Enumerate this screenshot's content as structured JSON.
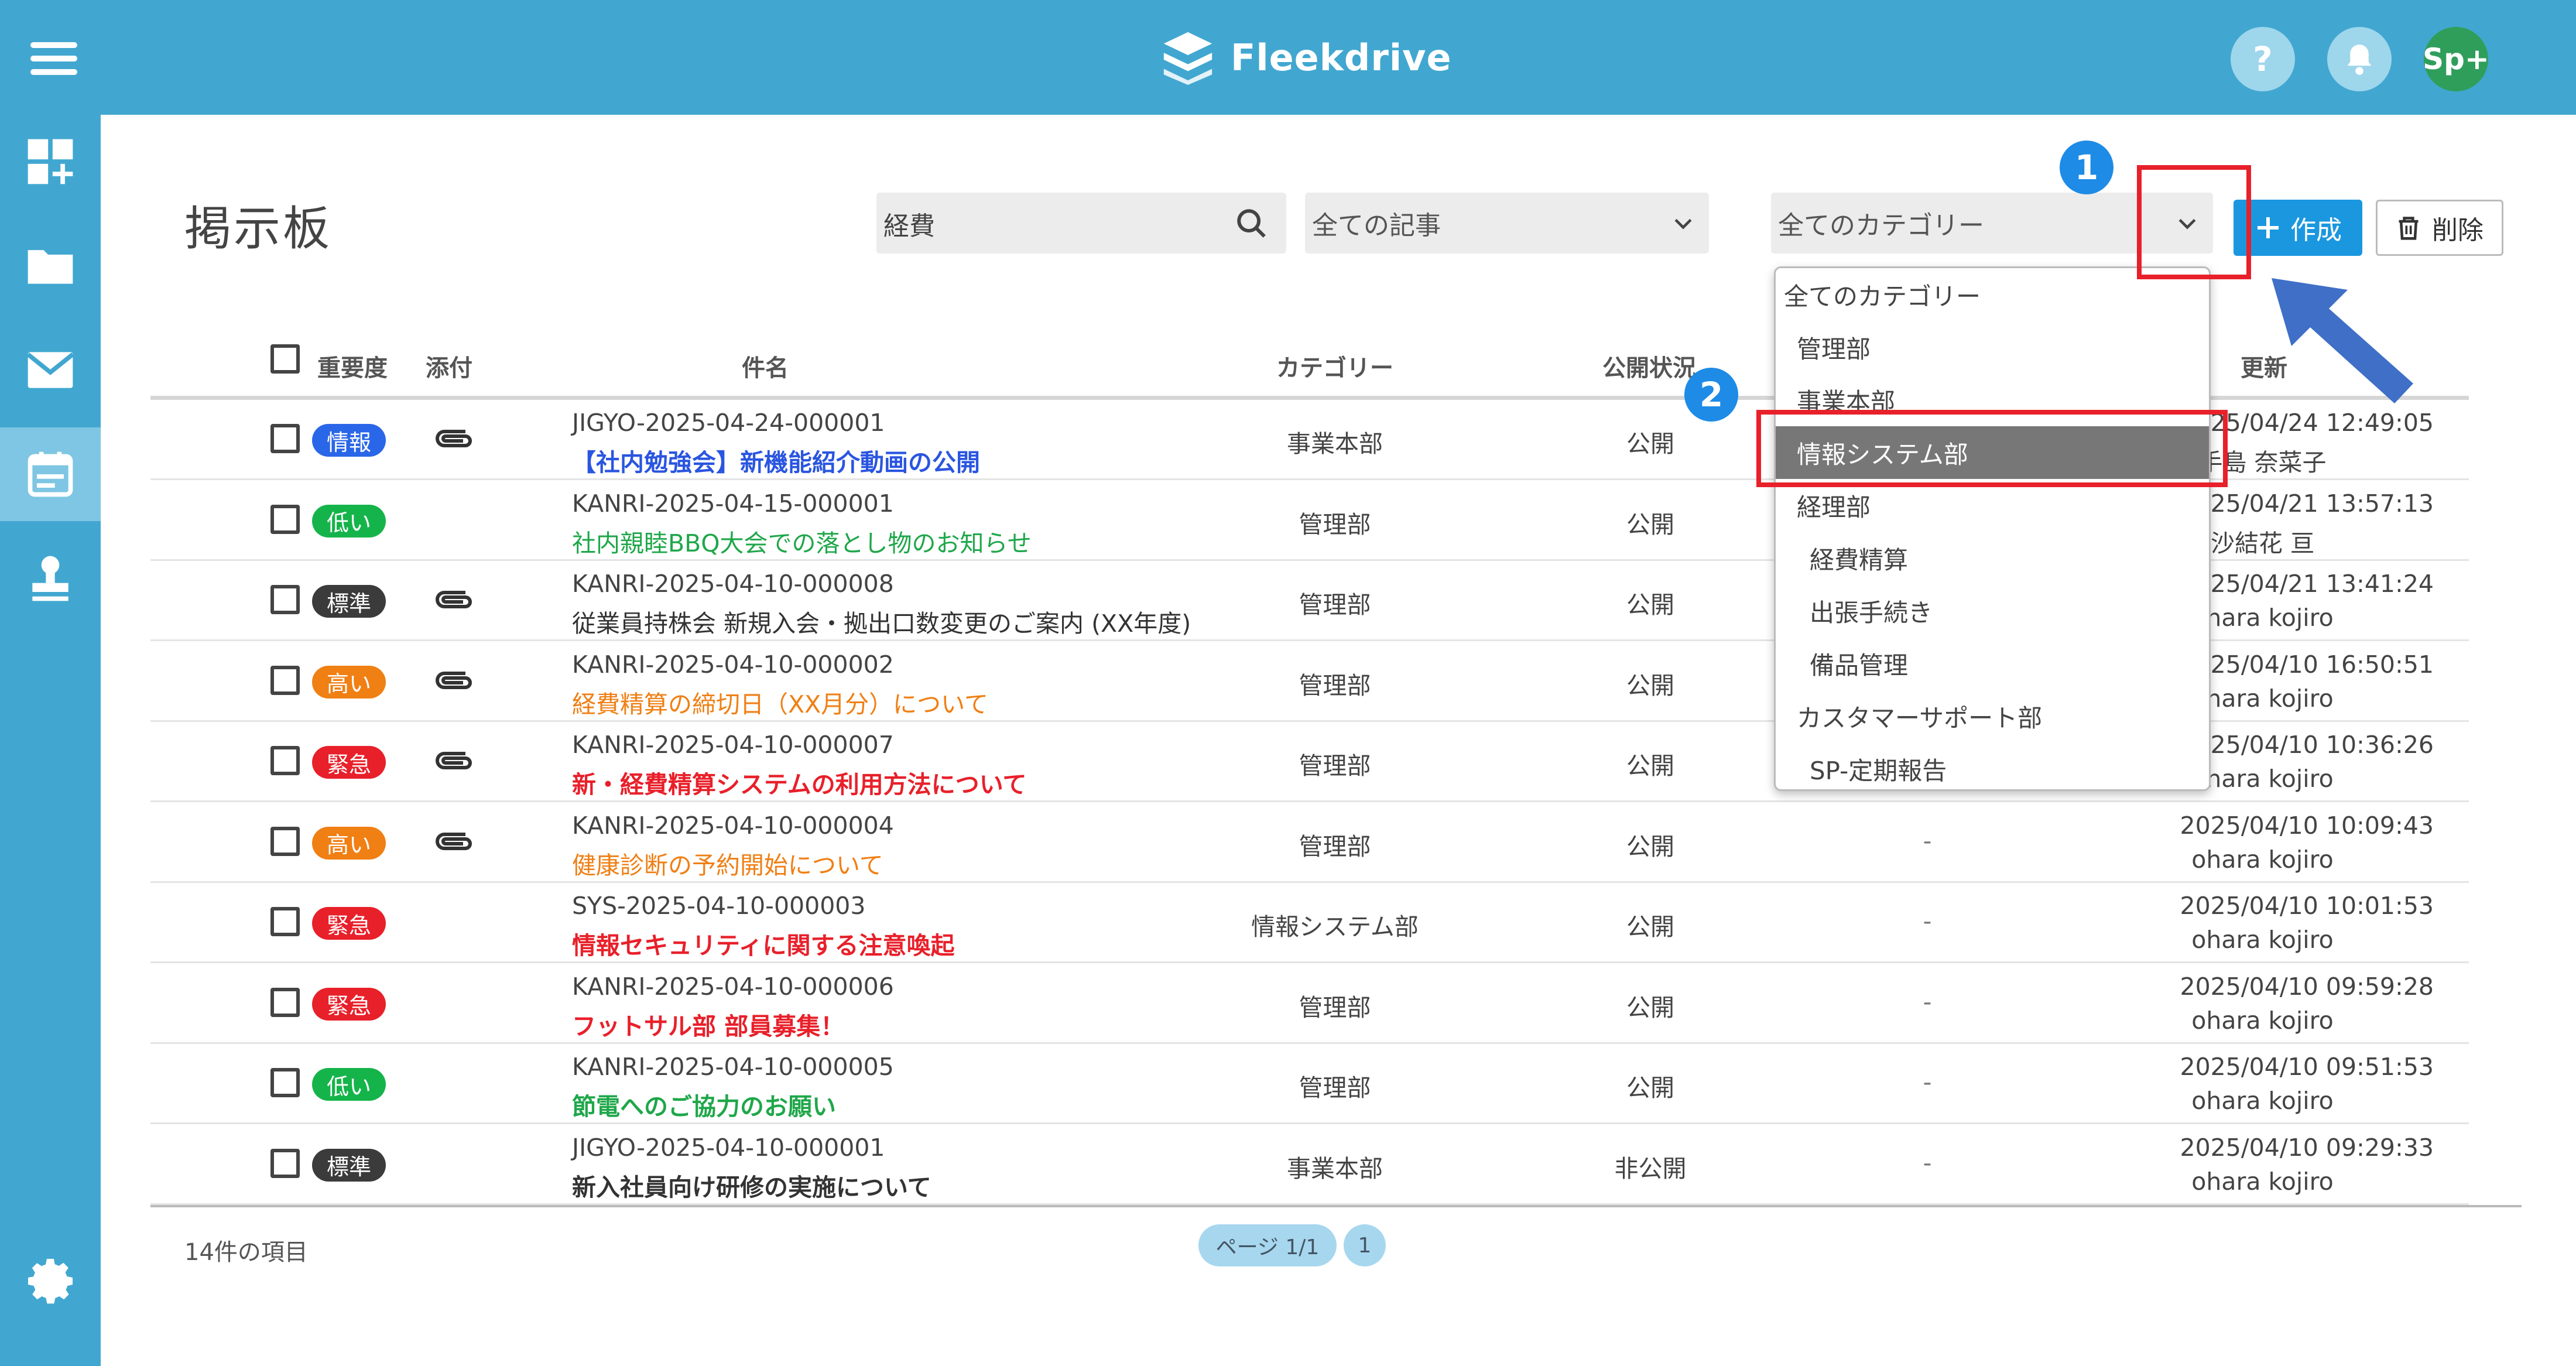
{
  "app": {
    "name": "Fleekdrive",
    "user_initials": "Sp+",
    "help_label": "?"
  },
  "page": {
    "title": "掲示板"
  },
  "filters": {
    "search_value": "経費",
    "article_filter": "全ての記事",
    "category_filter": "全てのカテゴリー"
  },
  "toolbar": {
    "create_label": "作成",
    "delete_label": "削除"
  },
  "table": {
    "headers": {
      "priority": "重要度",
      "attachment": "添付",
      "subject": "件名",
      "category": "カテゴリー",
      "status": "公開状況",
      "updated": "更新"
    },
    "rows": [
      {
        "priority": "情報",
        "priority_color": "#2a66e8",
        "clip": true,
        "id": "JIGYO-2025-04-24-000001",
        "subject": "【社内勉強会】新機能紹介動画の公開",
        "subject_color": "#2a55e0",
        "bold": true,
        "category": "事業本部",
        "status": "公開",
        "dash": "-",
        "updated": "2025/04/24 12:49:05",
        "updated_by": "手島 奈菜子"
      },
      {
        "priority": "低い",
        "priority_color": "#15b44a",
        "clip": false,
        "id": "KANRI-2025-04-15-000001",
        "subject": "社内親睦BBQ大会での落とし物のお知らせ",
        "subject_color": "#1fa74a",
        "bold": false,
        "category": "管理部",
        "status": "公開",
        "dash": "-",
        "updated": "2025/04/21 13:57:13",
        "updated_by": "沙結花 亘"
      },
      {
        "priority": "標準",
        "priority_color": "#3b3b3b",
        "clip": true,
        "id": "KANRI-2025-04-10-000008",
        "subject": "従業員持株会 新規入会・拠出口数変更のご案内 (XX年度)",
        "subject_color": "#333333",
        "bold": false,
        "category": "管理部",
        "status": "公開",
        "dash": "-",
        "updated": "2025/04/21 13:41:24",
        "updated_by": "ohara kojiro"
      },
      {
        "priority": "高い",
        "priority_color": "#f07f14",
        "clip": true,
        "id": "KANRI-2025-04-10-000002",
        "subject": "経費精算の締切日（XX月分）について",
        "subject_color": "#f07f14",
        "bold": false,
        "category": "管理部",
        "status": "公開",
        "dash": "-",
        "updated": "2025/04/10 16:50:51",
        "updated_by": "ohara kojiro"
      },
      {
        "priority": "緊急",
        "priority_color": "#e8202a",
        "clip": true,
        "id": "KANRI-2025-04-10-000007",
        "subject": "新・経費精算システムの利用方法について",
        "subject_color": "#e8202a",
        "bold": true,
        "category": "管理部",
        "status": "公開",
        "dash": "-",
        "updated": "2025/04/10 10:36:26",
        "updated_by": "ohara kojiro"
      },
      {
        "priority": "高い",
        "priority_color": "#f07f14",
        "clip": true,
        "id": "KANRI-2025-04-10-000004",
        "subject": "健康診断の予約開始について",
        "subject_color": "#f07f14",
        "bold": false,
        "category": "管理部",
        "status": "公開",
        "dash": "-",
        "updated": "2025/04/10 10:09:43",
        "updated_by": "ohara kojiro"
      },
      {
        "priority": "緊急",
        "priority_color": "#e8202a",
        "clip": false,
        "id": "SYS-2025-04-10-000003",
        "subject": "情報セキュリティに関する注意喚起",
        "subject_color": "#e8202a",
        "bold": true,
        "category": "情報システム部",
        "status": "公開",
        "dash": "-",
        "updated": "2025/04/10 10:01:53",
        "updated_by": "ohara kojiro"
      },
      {
        "priority": "緊急",
        "priority_color": "#e8202a",
        "clip": false,
        "id": "KANRI-2025-04-10-000006",
        "subject": "フットサル部 部員募集！",
        "subject_color": "#e8202a",
        "bold": true,
        "category": "管理部",
        "status": "公開",
        "dash": "-",
        "updated": "2025/04/10 09:59:28",
        "updated_by": "ohara kojiro"
      },
      {
        "priority": "低い",
        "priority_color": "#15b44a",
        "clip": false,
        "id": "KANRI-2025-04-10-000005",
        "subject": "節電へのご協力のお願い",
        "subject_color": "#1fa74a",
        "bold": true,
        "category": "管理部",
        "status": "公開",
        "dash": "-",
        "updated": "2025/04/10 09:51:53",
        "updated_by": "ohara kojiro"
      },
      {
        "priority": "標準",
        "priority_color": "#3b3b3b",
        "clip": false,
        "id": "JIGYO-2025-04-10-000001",
        "subject": "新入社員向け研修の実施について",
        "subject_color": "#333333",
        "bold": true,
        "category": "事業本部",
        "status": "非公開",
        "dash": "-",
        "updated": "2025/04/10 09:29:33",
        "updated_by": "ohara kojiro"
      }
    ]
  },
  "footer": {
    "item_count": "14件の項目",
    "page_label": "ページ 1/1",
    "page_number": "1"
  },
  "category_dropdown": {
    "options": [
      {
        "label": "全てのカテゴリー",
        "indent": 0,
        "selected": false
      },
      {
        "label": "管理部",
        "indent": 1,
        "selected": false
      },
      {
        "label": "事業本部",
        "indent": 1,
        "selected": false
      },
      {
        "label": "情報システム部",
        "indent": 1,
        "selected": true
      },
      {
        "label": "経理部",
        "indent": 1,
        "selected": false
      },
      {
        "label": "経費精算",
        "indent": 2,
        "selected": false
      },
      {
        "label": "出張手続き",
        "indent": 2,
        "selected": false
      },
      {
        "label": "備品管理",
        "indent": 2,
        "selected": false
      },
      {
        "label": "カスタマーサポート部",
        "indent": 1,
        "selected": false
      },
      {
        "label": "SP-定期報告",
        "indent": 2,
        "selected": false
      }
    ]
  },
  "annotations": {
    "step1": "1",
    "step2": "2",
    "highlight_color": "#e8202a",
    "step_color": "#1e8be6"
  },
  "colors": {
    "brand": "#41a7d0",
    "primary_button": "#1b97e0"
  }
}
